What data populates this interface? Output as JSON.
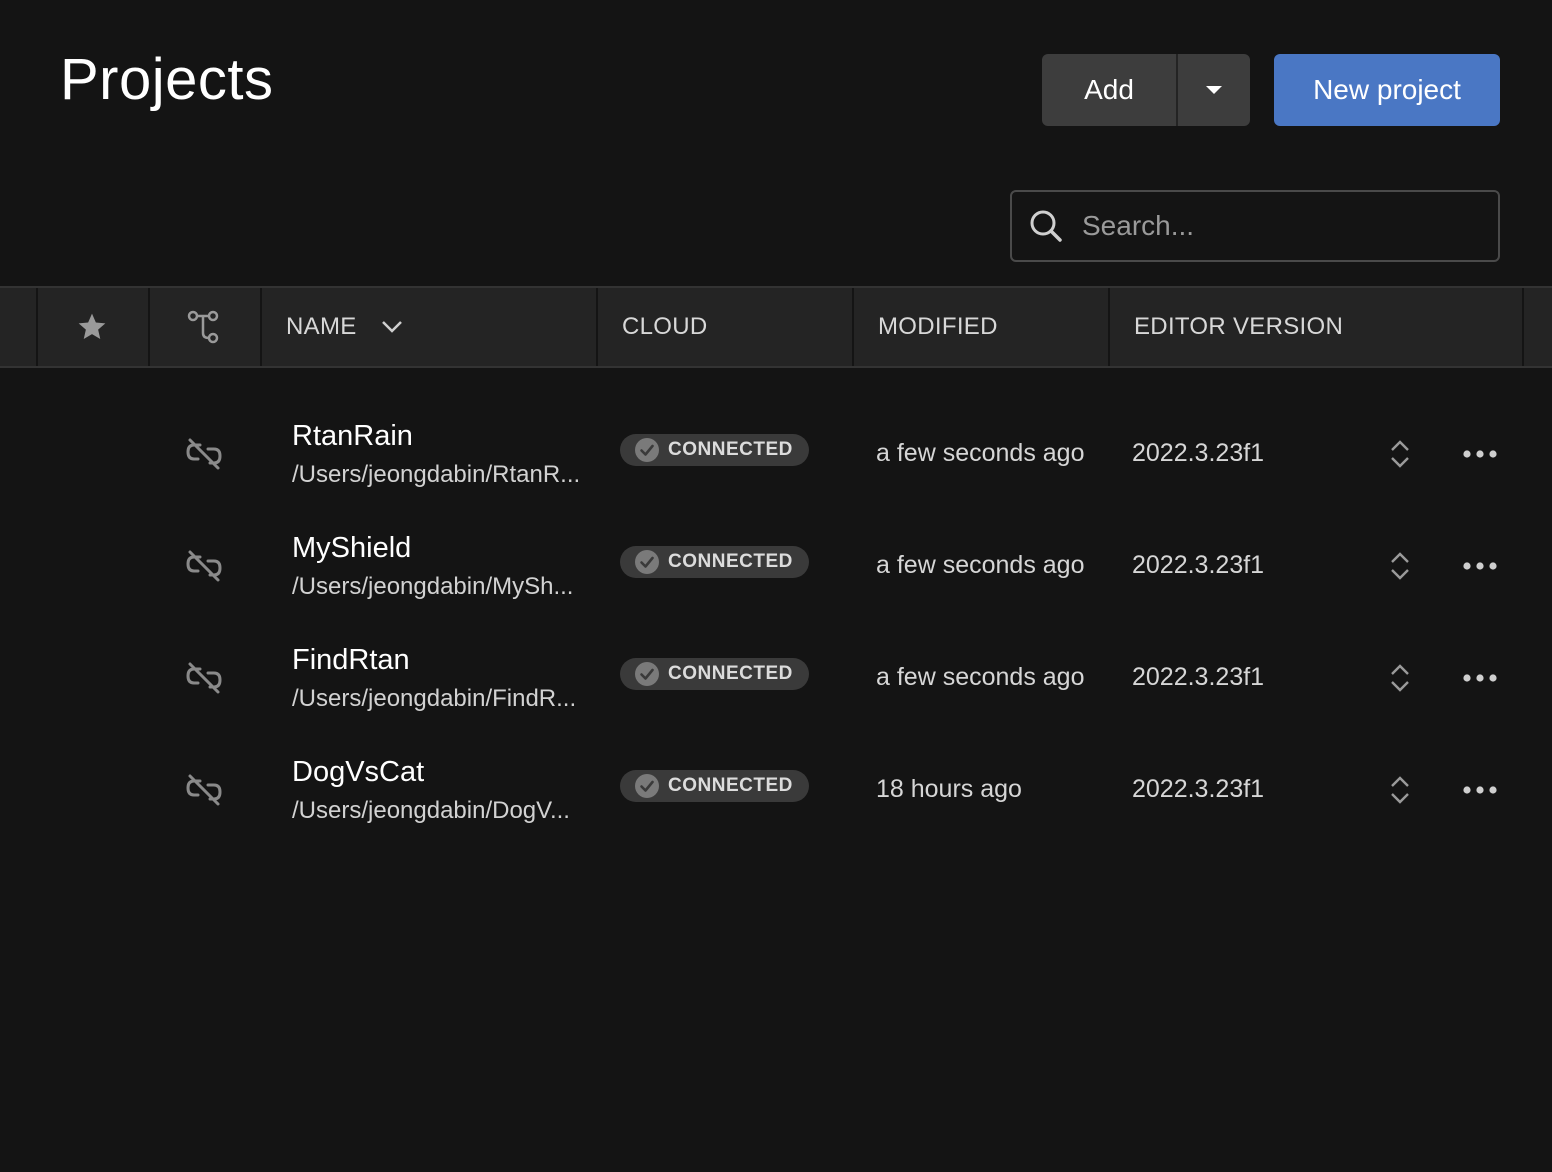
{
  "header": {
    "title": "Projects",
    "add_label": "Add",
    "new_project_label": "New project"
  },
  "search": {
    "placeholder": "Search..."
  },
  "columns": {
    "name": "NAME",
    "cloud": "CLOUD",
    "modified": "MODIFIED",
    "editor_version": "EDITOR VERSION"
  },
  "projects": [
    {
      "name": "RtanRain",
      "path": "/Users/jeongdabin/RtanR...",
      "cloud": "CONNECTED",
      "modified": "a few seconds ago",
      "version": "2022.3.23f1"
    },
    {
      "name": "MyShield",
      "path": "/Users/jeongdabin/MySh...",
      "cloud": "CONNECTED",
      "modified": "a few seconds ago",
      "version": "2022.3.23f1"
    },
    {
      "name": "FindRtan",
      "path": "/Users/jeongdabin/FindR...",
      "cloud": "CONNECTED",
      "modified": "a few seconds ago",
      "version": "2022.3.23f1"
    },
    {
      "name": "DogVsCat",
      "path": "/Users/jeongdabin/DogV...",
      "cloud": "CONNECTED",
      "modified": "18 hours ago",
      "version": "2022.3.23f1"
    }
  ],
  "colors": {
    "background": "#141414",
    "header_row": "#242424",
    "primary_button": "#4a77c4",
    "secondary_button": "#3d3d3d",
    "badge": "#3a3a3a"
  }
}
